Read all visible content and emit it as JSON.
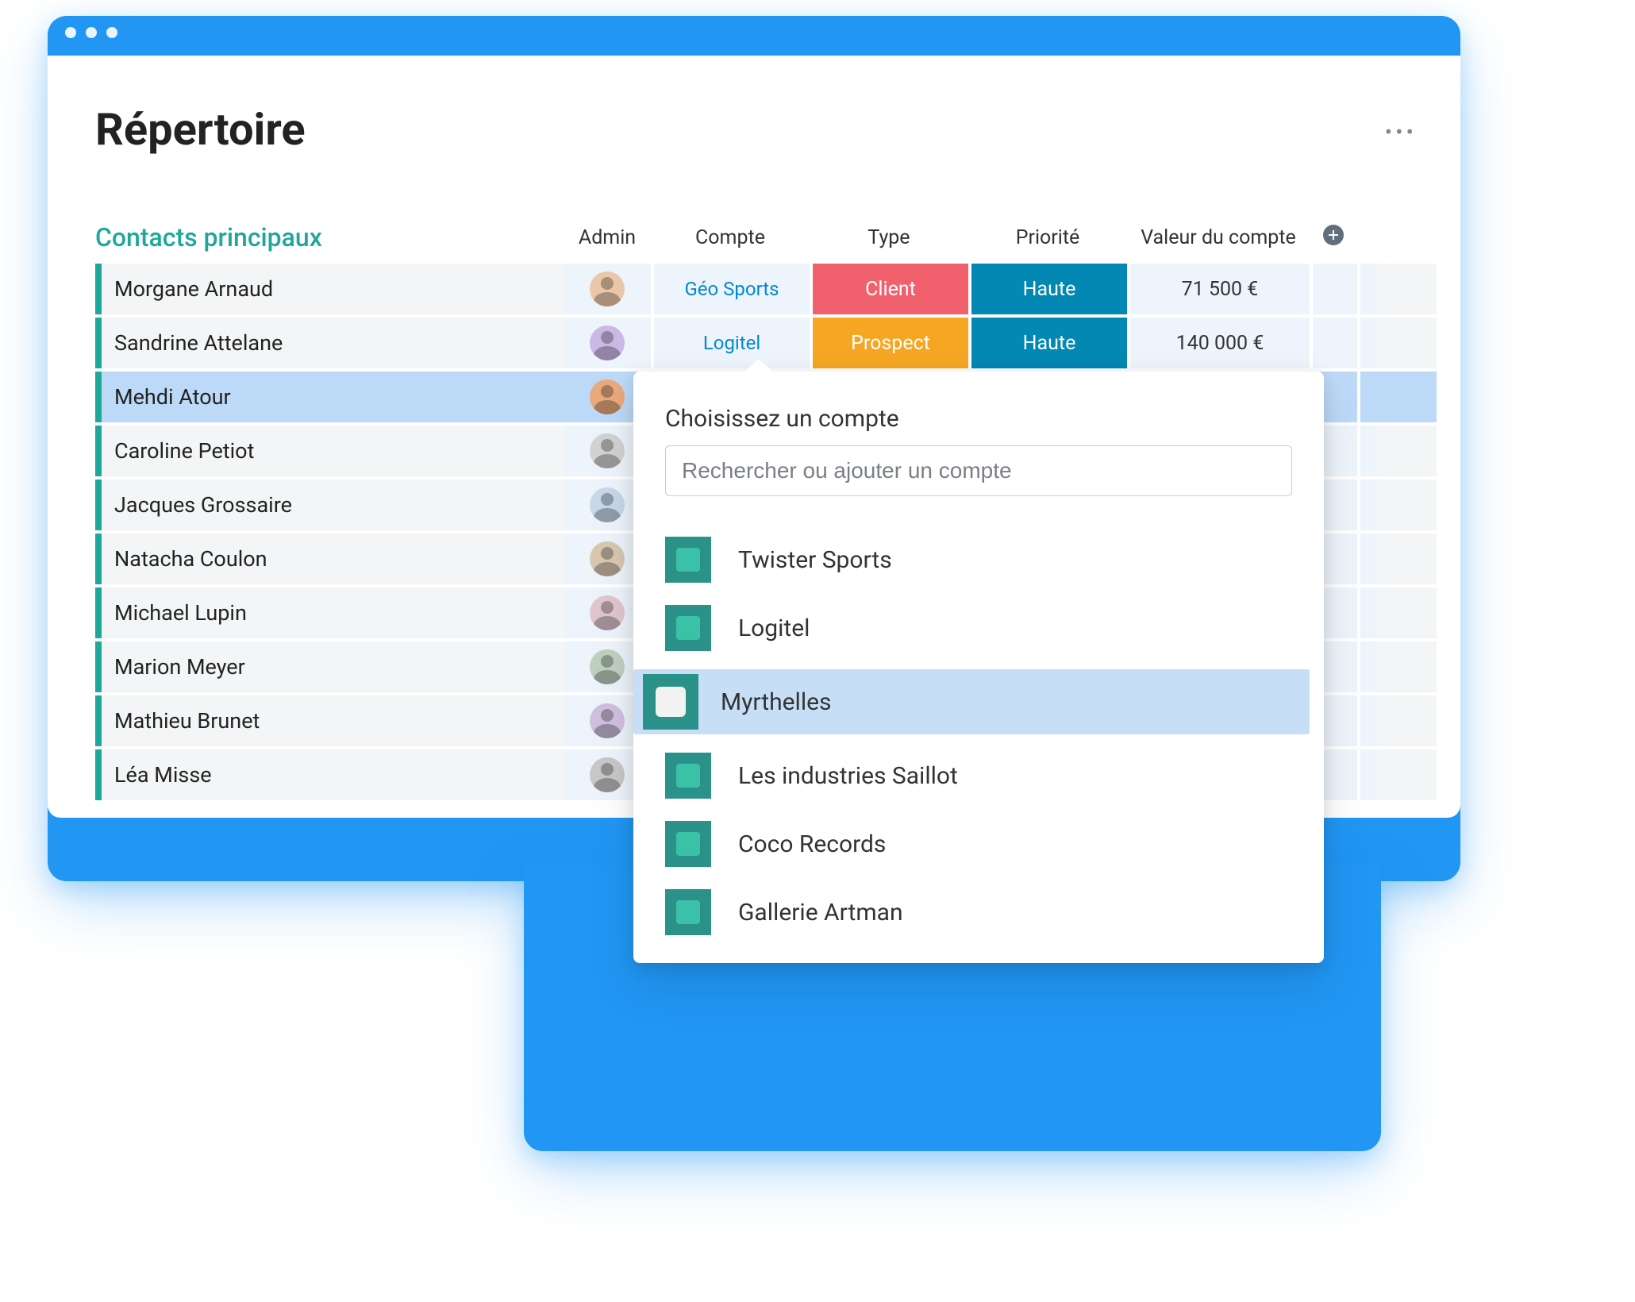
{
  "page": {
    "title": "Répertoire"
  },
  "table": {
    "section_title": "Contacts principaux",
    "headers": {
      "admin": "Admin",
      "compte": "Compte",
      "type": "Type",
      "prio": "Priorité",
      "valeur": "Valeur du compte"
    },
    "rows": [
      {
        "name": "Morgane Arnaud",
        "compte": "Géo Sports",
        "type": "Client",
        "prio": "Haute",
        "valeur": "71 500 €",
        "selected": false
      },
      {
        "name": "Sandrine Attelane",
        "compte": "Logitel",
        "type": "Prospect",
        "prio": "Haute",
        "valeur": "140 000 €",
        "selected": false
      },
      {
        "name": "Mehdi Atour",
        "compte": "",
        "type": "",
        "prio": "",
        "valeur": "",
        "selected": true
      },
      {
        "name": "Caroline Petiot",
        "compte": "",
        "type": "",
        "prio": "",
        "valeur": "",
        "selected": false
      },
      {
        "name": "Jacques Grossaire",
        "compte": "",
        "type": "",
        "prio": "",
        "valeur": "",
        "selected": false
      },
      {
        "name": "Natacha Coulon",
        "compte": "",
        "type": "",
        "prio": "",
        "valeur": "",
        "selected": false
      },
      {
        "name": "Michael Lupin",
        "compte": "",
        "type": "",
        "prio": "",
        "valeur": "",
        "selected": false
      },
      {
        "name": "Marion Meyer",
        "compte": "",
        "type": "",
        "prio": "",
        "valeur": "",
        "selected": false
      },
      {
        "name": "Mathieu Brunet",
        "compte": "",
        "type": "",
        "prio": "",
        "valeur": "",
        "selected": false
      },
      {
        "name": "Léa Misse",
        "compte": "",
        "type": "",
        "prio": "",
        "valeur": "",
        "selected": false
      }
    ]
  },
  "popover": {
    "title": "Choisissez un compte",
    "search_placeholder": "Rechercher ou ajouter un compte",
    "options": [
      {
        "label": "Twister Sports",
        "highlight": false
      },
      {
        "label": "Logitel",
        "highlight": false
      },
      {
        "label": "Myrthelles",
        "highlight": true
      },
      {
        "label": "Les industries Saillot",
        "highlight": false
      },
      {
        "label": "Coco Records",
        "highlight": false
      },
      {
        "label": "Gallerie Artman",
        "highlight": false
      }
    ]
  },
  "colors": {
    "brand_blue": "#2196f3",
    "teal": "#1fa89a",
    "client": "#f0616d",
    "prospect": "#f5a623",
    "haute": "#0288b3"
  }
}
